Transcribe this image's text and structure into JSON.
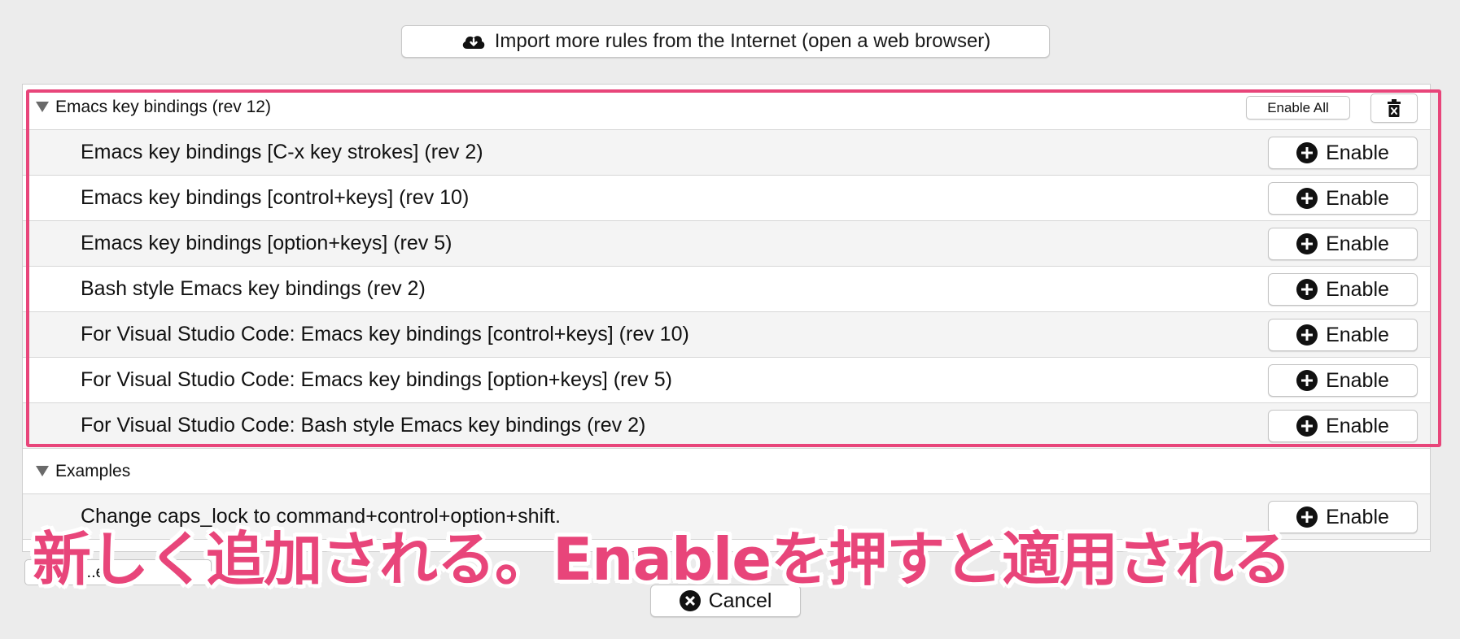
{
  "header": {
    "import_label": "Import more rules from the Internet (open a web browser)"
  },
  "groups": [
    {
      "title": "Emacs key bindings (rev 12)",
      "enable_all_label": "Enable All",
      "rules": [
        {
          "label": "Emacs key bindings [C-x key strokes] (rev 2)",
          "button": "Enable"
        },
        {
          "label": "Emacs key bindings [control+keys] (rev 10)",
          "button": "Enable"
        },
        {
          "label": "Emacs key bindings [option+keys] (rev 5)",
          "button": "Enable"
        },
        {
          "label": "Bash style Emacs key bindings (rev 2)",
          "button": "Enable"
        },
        {
          "label": "For Visual Studio Code: Emacs key bindings [control+keys] (rev 10)",
          "button": "Enable"
        },
        {
          "label": "For Visual Studio Code: Emacs key bindings [option+keys] (rev 5)",
          "button": "Enable"
        },
        {
          "label": "For Visual Studio Code: Bash style Emacs key bindings (rev 2)",
          "button": "Enable"
        }
      ]
    },
    {
      "title": "Examples",
      "rules": [
        {
          "label": "Change caps_lock to command+control+option+shift.",
          "button": "Enable"
        }
      ]
    }
  ],
  "footer": {
    "left_button_label": "...ee...",
    "cancel_label": "Cancel"
  },
  "annotation": {
    "caption": "新しく追加される。Enableを押すと適用される",
    "color": "#e8457a"
  },
  "icons": {
    "import": "cloud-download-icon",
    "enable": "plus-circle-icon",
    "delete": "trash-icon",
    "cancel": "x-circle-icon",
    "disclosure": "disclosure-triangle-icon"
  }
}
